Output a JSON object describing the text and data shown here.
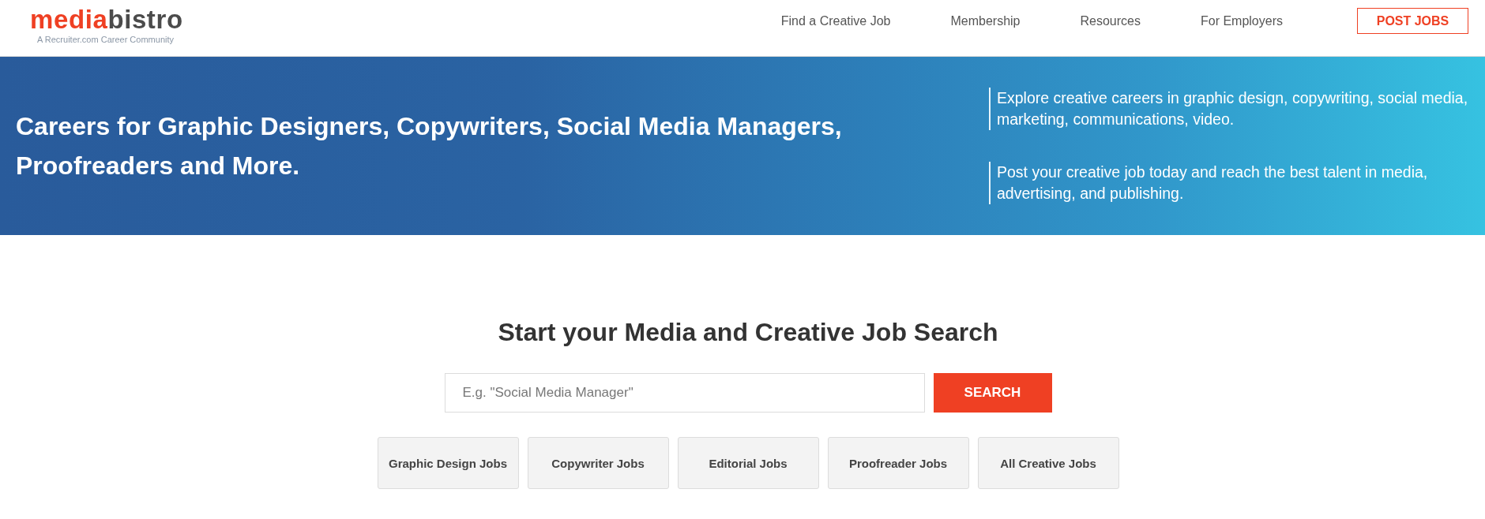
{
  "header": {
    "logo": {
      "accent": "media",
      "rest": "bistro",
      "tagline": "A Recruiter.com Career Community"
    },
    "nav": [
      "Find a Creative Job",
      "Membership",
      "Resources",
      "For Employers"
    ],
    "cta": "POST JOBS"
  },
  "hero": {
    "headline": "Careers for Graphic Designers, Copywriters, Social Media Managers, Proofreaders and More.",
    "blurbs": [
      "Explore creative careers in graphic design, copywriting, social media, marketing, communications, video.",
      "Post your creative job today and reach the best talent in media, advertising, and publishing."
    ]
  },
  "search": {
    "title": "Start your Media and Creative Job Search",
    "placeholder": "E.g. \"Social Media Manager\"",
    "button": "SEARCH"
  },
  "categories": [
    "Graphic Design Jobs",
    "Copywriter Jobs",
    "Editorial Jobs",
    "Proofreader Jobs",
    "All Creative Jobs"
  ]
}
